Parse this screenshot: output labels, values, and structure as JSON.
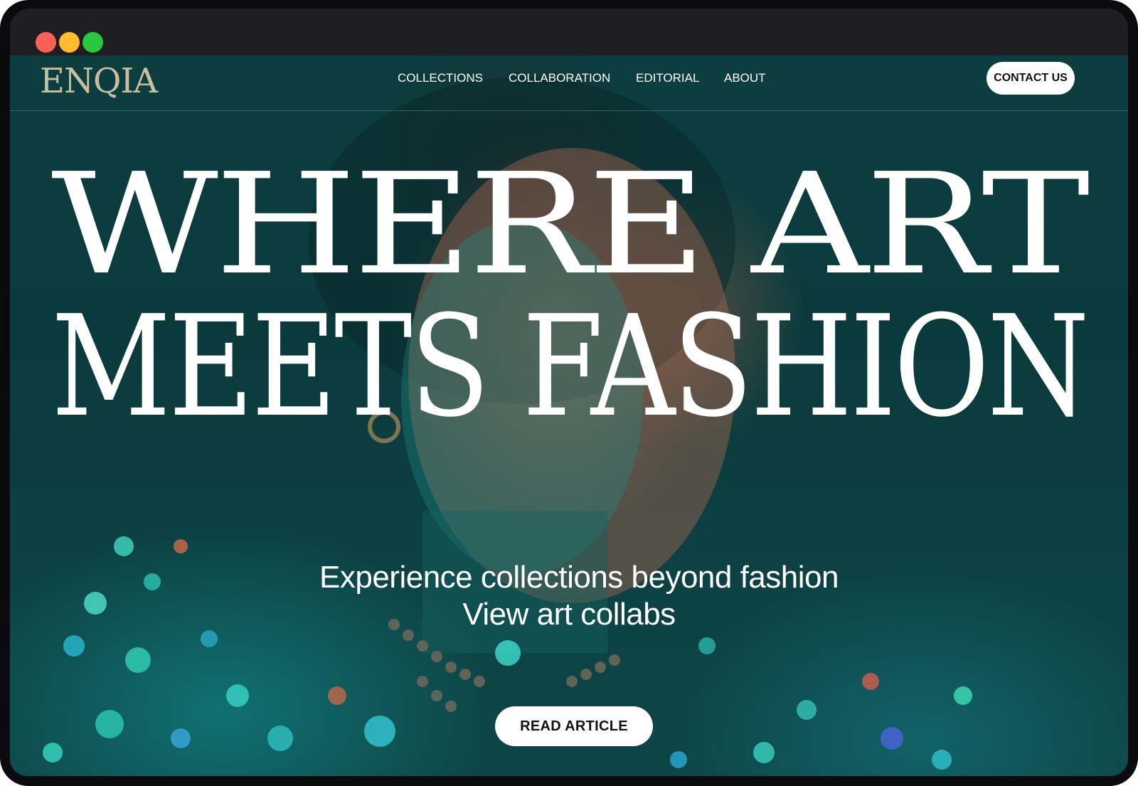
{
  "window": {
    "controls": [
      "close",
      "minimize",
      "maximize"
    ]
  },
  "site": {
    "logo": "ENQIA",
    "nav": [
      {
        "label": "COLLECTIONS"
      },
      {
        "label": "COLLABORATION"
      },
      {
        "label": "EDITORIAL"
      },
      {
        "label": "ABOUT"
      }
    ],
    "contact_label": "CONTACT US"
  },
  "hero": {
    "line1": "WHERE ART",
    "line2": "MEETS FASHION",
    "subtitle1": "Experience collections beyond fashion",
    "subtitle2": "View art collabs",
    "cta_label": "READ ARTICLE"
  },
  "colors": {
    "background": "#0c3d3f",
    "logo": "#c8bfa0",
    "text": "#ffffff",
    "button_bg": "#ffffff",
    "button_text": "#111111",
    "titlebar": "#1f1f23",
    "close": "#fe5f57",
    "minimize": "#febc2e",
    "maximize": "#28c840"
  }
}
